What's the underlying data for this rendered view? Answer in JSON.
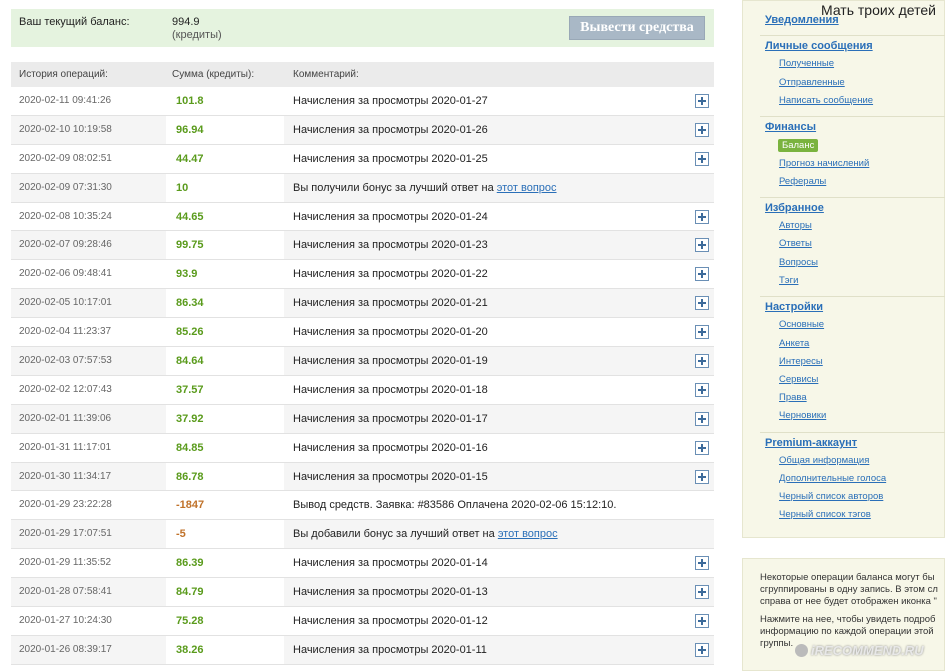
{
  "balance": {
    "label": "Ваш текущий баланс:",
    "value": "994.9",
    "unit": "(кредиты)",
    "withdraw_label": "Вывести средства"
  },
  "table": {
    "headers": [
      "История операций:",
      "Сумма (кредиты):",
      "Комментарий:"
    ],
    "rows": [
      {
        "date": "2020-02-11 09:41:26",
        "sum": "101.8",
        "comment": "Начисления за просмотры 2020-01-27",
        "link": "",
        "plus": true,
        "neg": false
      },
      {
        "date": "2020-02-10 10:19:58",
        "sum": "96.94",
        "comment": "Начисления за просмотры 2020-01-26",
        "link": "",
        "plus": true,
        "neg": false
      },
      {
        "date": "2020-02-09 08:02:51",
        "sum": "44.47",
        "comment": "Начисления за просмотры 2020-01-25",
        "link": "",
        "plus": true,
        "neg": false
      },
      {
        "date": "2020-02-09 07:31:30",
        "sum": "10",
        "comment": "Вы получили бонус за лучший ответ на ",
        "link": "этот вопрос",
        "plus": false,
        "neg": false
      },
      {
        "date": "2020-02-08 10:35:24",
        "sum": "44.65",
        "comment": "Начисления за просмотры 2020-01-24",
        "link": "",
        "plus": true,
        "neg": false
      },
      {
        "date": "2020-02-07 09:28:46",
        "sum": "99.75",
        "comment": "Начисления за просмотры 2020-01-23",
        "link": "",
        "plus": true,
        "neg": false
      },
      {
        "date": "2020-02-06 09:48:41",
        "sum": "93.9",
        "comment": "Начисления за просмотры 2020-01-22",
        "link": "",
        "plus": true,
        "neg": false
      },
      {
        "date": "2020-02-05 10:17:01",
        "sum": "86.34",
        "comment": "Начисления за просмотры 2020-01-21",
        "link": "",
        "plus": true,
        "neg": false
      },
      {
        "date": "2020-02-04 11:23:37",
        "sum": "85.26",
        "comment": "Начисления за просмотры 2020-01-20",
        "link": "",
        "plus": true,
        "neg": false
      },
      {
        "date": "2020-02-03 07:57:53",
        "sum": "84.64",
        "comment": "Начисления за просмотры 2020-01-19",
        "link": "",
        "plus": true,
        "neg": false
      },
      {
        "date": "2020-02-02 12:07:43",
        "sum": "37.57",
        "comment": "Начисления за просмотры 2020-01-18",
        "link": "",
        "plus": true,
        "neg": false
      },
      {
        "date": "2020-02-01 11:39:06",
        "sum": "37.92",
        "comment": "Начисления за просмотры 2020-01-17",
        "link": "",
        "plus": true,
        "neg": false
      },
      {
        "date": "2020-01-31 11:17:01",
        "sum": "84.85",
        "comment": "Начисления за просмотры 2020-01-16",
        "link": "",
        "plus": true,
        "neg": false
      },
      {
        "date": "2020-01-30 11:34:17",
        "sum": "86.78",
        "comment": "Начисления за просмотры 2020-01-15",
        "link": "",
        "plus": true,
        "neg": false
      },
      {
        "date": "2020-01-29 23:22:28",
        "sum": "-1847",
        "comment": "Вывод средств. Заявка: #83586 Оплачена 2020-02-06 15:12:10.",
        "link": "",
        "plus": false,
        "neg": true
      },
      {
        "date": "2020-01-29 17:07:51",
        "sum": "-5",
        "comment": "Вы добавили бонус за лучший ответ на ",
        "link": "этот вопрос",
        "plus": false,
        "neg": true
      },
      {
        "date": "2020-01-29 11:35:52",
        "sum": "86.39",
        "comment": "Начисления за просмотры 2020-01-14",
        "link": "",
        "plus": true,
        "neg": false
      },
      {
        "date": "2020-01-28 07:58:41",
        "sum": "84.79",
        "comment": "Начисления за просмотры 2020-01-13",
        "link": "",
        "plus": true,
        "neg": false
      },
      {
        "date": "2020-01-27 10:24:30",
        "sum": "75.28",
        "comment": "Начисления за просмотры 2020-01-12",
        "link": "",
        "plus": true,
        "neg": false
      },
      {
        "date": "2020-01-26 08:39:17",
        "sum": "38.26",
        "comment": "Начисления за просмотры 2020-01-11",
        "link": "",
        "plus": true,
        "neg": false
      }
    ]
  },
  "sidebar": {
    "profile_name": "Мать троих детей",
    "sections": [
      {
        "title": "Уведомления",
        "items": []
      },
      {
        "title": "Личные сообщения",
        "items": [
          "Полученные",
          "Отправленные",
          "Написать сообщение"
        ]
      },
      {
        "title": "Финансы",
        "items": [
          "Баланс",
          "Прогноз начислений",
          "Рефералы"
        ],
        "active": "Баланс"
      },
      {
        "title": "Избранное",
        "items": [
          "Авторы",
          "Ответы",
          "Вопросы",
          "Тэги"
        ]
      },
      {
        "title": "Настройки",
        "items": [
          "Основные",
          "Анкета",
          "Интересы",
          "Сервисы",
          "Права",
          "Черновики"
        ]
      },
      {
        "title": "Premium-аккаунт",
        "items": [
          "Общая информация",
          "Дополнительные голоса",
          "Черный список авторов",
          "Черный список тэгов"
        ]
      }
    ]
  },
  "info": {
    "lines": [
      "Некоторые операции баланса могут бы",
      "сгруппированы в одну запись. В этом сл",
      "справа от нее будет отображен иконка \"",
      "",
      "Нажмите на нее, чтобы увидеть подроб",
      "информацию по каждой операции этой",
      "группы."
    ]
  },
  "watermark": "iRECOMMEND.RU"
}
